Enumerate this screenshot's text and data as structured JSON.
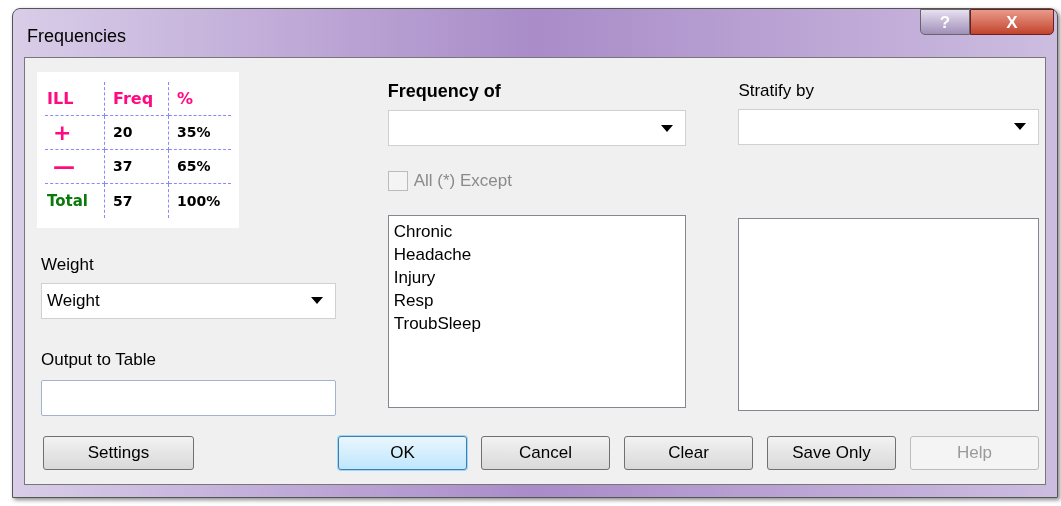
{
  "window": {
    "title": "Frequencies",
    "help_button": "?",
    "close_button": "X"
  },
  "illustration": {
    "header": [
      "ILL",
      "Freq",
      "%"
    ],
    "rows": [
      [
        "+",
        "20",
        "35%"
      ],
      [
        "—",
        "37",
        "65%"
      ],
      [
        "Total",
        "57",
        "100%"
      ]
    ]
  },
  "weight": {
    "label": "Weight",
    "value": "Weight"
  },
  "output_to_table": {
    "label": "Output to Table"
  },
  "frequency_of": {
    "label": "Frequency of"
  },
  "all_except": {
    "label": "All (*) Except",
    "checked": false,
    "disabled": true
  },
  "variables": [
    "Chronic",
    "Headache",
    "Injury",
    "Resp",
    "TroubSleep"
  ],
  "stratify_by": {
    "label": "Stratify by"
  },
  "buttons": [
    {
      "label": "Settings",
      "default": false,
      "disabled": false
    },
    {
      "label": "OK",
      "default": true,
      "disabled": false
    },
    {
      "label": "Cancel",
      "default": false,
      "disabled": false
    },
    {
      "label": "Clear",
      "default": false,
      "disabled": false
    },
    {
      "label": "Save Only",
      "default": false,
      "disabled": false
    },
    {
      "label": "Help",
      "default": false,
      "disabled": true
    }
  ]
}
